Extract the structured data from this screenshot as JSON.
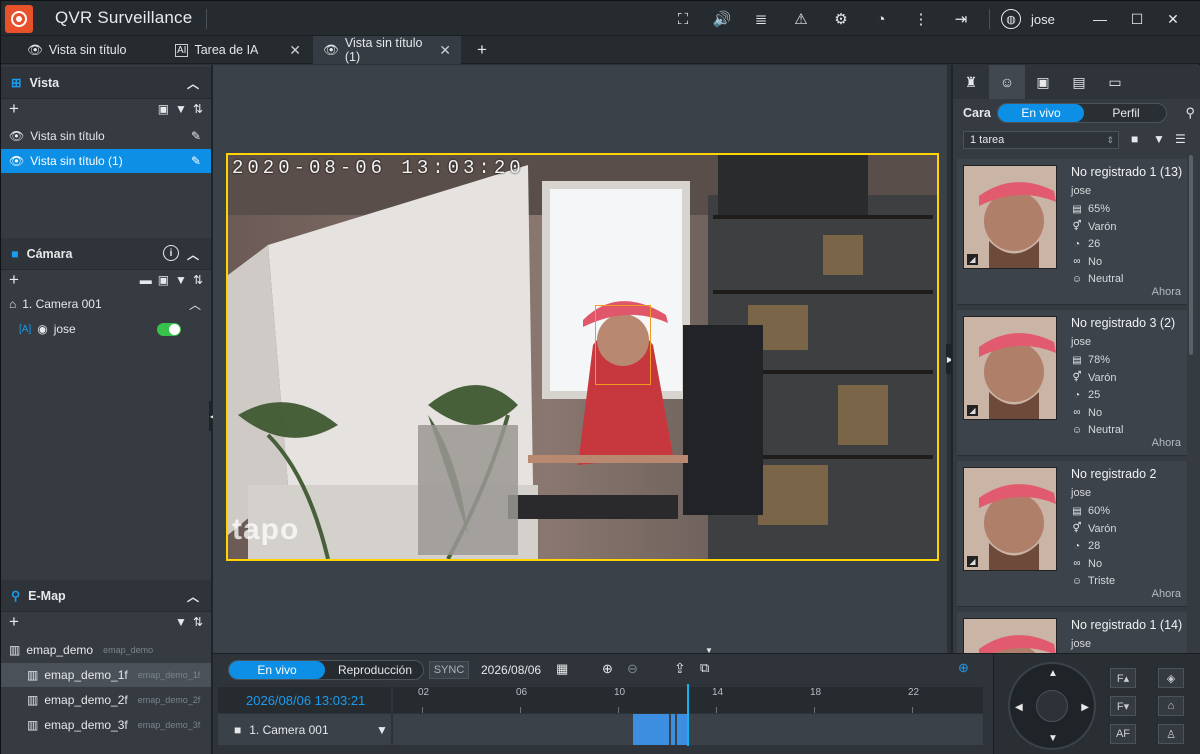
{
  "app": {
    "title": "QVR Surveillance",
    "user": "jose"
  },
  "tabs": [
    {
      "label": "Vista sin título"
    },
    {
      "label": "Tarea de IA"
    },
    {
      "label": "Vista sin título (1)"
    }
  ],
  "left": {
    "vista": {
      "title": "Vista",
      "items": [
        "Vista sin título",
        "Vista sin título (1)"
      ]
    },
    "camara": {
      "title": "Cámara",
      "camera": "1. Camera 001",
      "tracker": "jose"
    },
    "emap": {
      "title": "E-Map",
      "root": "emap_demo",
      "root_sub": "emap_demo",
      "items": [
        {
          "label": "emap_demo_1f",
          "sub": "emap_demo_1f"
        },
        {
          "label": "emap_demo_2f",
          "sub": "emap_demo_2f"
        },
        {
          "label": "emap_demo_3f",
          "sub": "emap_demo_3f"
        }
      ]
    }
  },
  "video": {
    "timestamp": "2020-08-06 13:03:20",
    "watermark": "tapo"
  },
  "right": {
    "cara_label": "Cara",
    "seg_live": "En vivo",
    "seg_profile": "Perfil",
    "task_select": "1 tarea",
    "cards": [
      {
        "name": "No registrado 1 (13)",
        "user": "jose",
        "confidence": "65%",
        "gender": "Varón",
        "age": "26",
        "glasses": "No",
        "emotion": "Neutral",
        "time": "Ahora"
      },
      {
        "name": "No registrado 3 (2)",
        "user": "jose",
        "confidence": "78%",
        "gender": "Varón",
        "age": "25",
        "glasses": "No",
        "emotion": "Neutral",
        "time": "Ahora"
      },
      {
        "name": "No registrado 2",
        "user": "jose",
        "confidence": "60%",
        "gender": "Varón",
        "age": "28",
        "glasses": "No",
        "emotion": "Triste",
        "time": "Ahora"
      },
      {
        "name": "No registrado 1 (14)",
        "user": "jose"
      }
    ]
  },
  "bottom": {
    "seg_live": "En vivo",
    "seg_playback": "Reproducción",
    "sync": "SYNC",
    "date": "2026/08/06",
    "datetime": "2026/08/06 13:03:21",
    "camera": "1. Camera 001",
    "ticks": [
      "02",
      "06",
      "10",
      "14",
      "18",
      "22"
    ]
  },
  "colors": {
    "accent": "#0d8fe6",
    "frame": "#ffd400",
    "toggle": "#39c24a",
    "logo": "#e8522b"
  }
}
